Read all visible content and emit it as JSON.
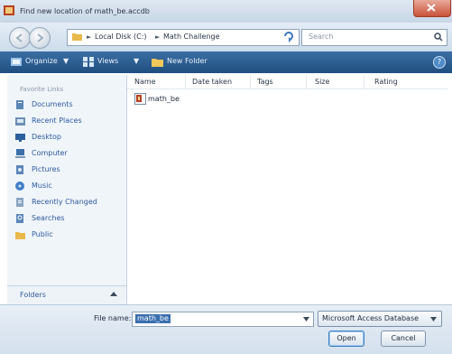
{
  "window": {
    "title": "Find new location of math_be.accdb"
  },
  "address": {
    "crumbs": [
      "Local Disk (C:)",
      "Math Challenge"
    ],
    "search_placeholder": "Search"
  },
  "toolbar": {
    "organize_label": "Organize",
    "views_label": "Views",
    "new_folder_label": "New Folder"
  },
  "navigation": {
    "heading": "Favorite Links",
    "items": [
      {
        "label": "Documents",
        "icon": "documents-icon"
      },
      {
        "label": "Recent Places",
        "icon": "recent-places-icon"
      },
      {
        "label": "Desktop",
        "icon": "desktop-icon"
      },
      {
        "label": "Computer",
        "icon": "computer-icon"
      },
      {
        "label": "Pictures",
        "icon": "pictures-icon"
      },
      {
        "label": "Music",
        "icon": "music-icon"
      },
      {
        "label": "Recently Changed",
        "icon": "recently-changed-icon"
      },
      {
        "label": "Searches",
        "icon": "searches-icon"
      },
      {
        "label": "Public",
        "icon": "public-icon"
      }
    ],
    "folders_label": "Folders"
  },
  "file_list": {
    "columns": [
      "Name",
      "Date taken",
      "Tags",
      "Size",
      "Rating"
    ],
    "files": [
      {
        "name": "math_be"
      }
    ]
  },
  "footer": {
    "file_name_label": "File name:",
    "file_name_value": "math_be",
    "file_type": "Microsoft Access Database",
    "open_label": "Open",
    "cancel_label": "Cancel"
  },
  "colors": {
    "toolbar": "#1f4f80",
    "link_text": "#2c5aa0",
    "selection": "#3a6fb0",
    "close_button": "#c9533b"
  }
}
